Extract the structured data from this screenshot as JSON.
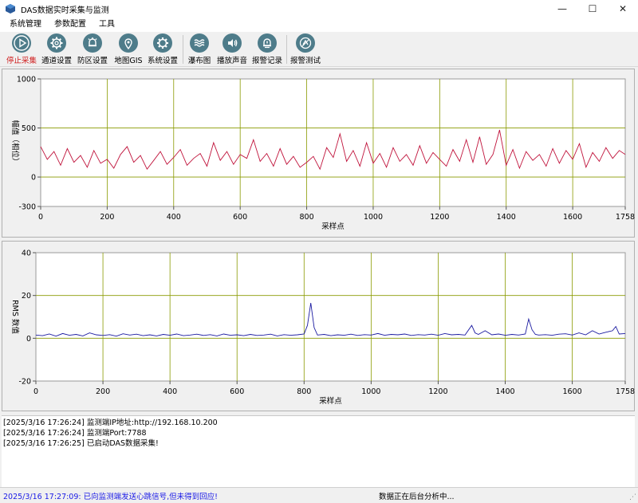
{
  "window": {
    "title": "DAS数据实时采集与监测",
    "minimize": "—",
    "maximize": "☐",
    "close": "✕"
  },
  "menu": [
    "系统管理",
    "参数配置",
    "工具"
  ],
  "toolbar": [
    {
      "label": "停止采集",
      "icon": "play-icon",
      "active": true
    },
    {
      "label": "通道设置",
      "icon": "gear-icon"
    },
    {
      "label": "防区设置",
      "icon": "alarm-bell-icon"
    },
    {
      "label": "地图GIS",
      "icon": "map-pin-icon"
    },
    {
      "label": "系统设置",
      "icon": "settings-icon"
    },
    {
      "label": "瀑布图",
      "icon": "waterfall-icon"
    },
    {
      "label": "播放声音",
      "icon": "speaker-icon"
    },
    {
      "label": "报警记录",
      "icon": "alarm-record-icon"
    },
    {
      "label": "报警测试",
      "icon": "alarm-test-icon"
    }
  ],
  "colors": {
    "grid": "#8a9a00",
    "series1": "#c0143c",
    "series2": "#1a1aa0",
    "accent_red": "#d02020",
    "status_blue": "#1a1ae6"
  },
  "chart_data": [
    {
      "type": "line",
      "title": "",
      "xlabel": "采样点",
      "ylabel": "幅值（相位）",
      "xlim": [
        0,
        1758
      ],
      "ylim": [
        -300,
        1000
      ],
      "xticks": [
        0,
        200,
        400,
        600,
        800,
        1000,
        1200,
        1400,
        1600,
        1758
      ],
      "yticks": [
        -300,
        0,
        500,
        1000
      ],
      "grid": true,
      "series": [
        {
          "x": [
            0,
            20,
            40,
            60,
            80,
            100,
            120,
            140,
            160,
            180,
            200,
            220,
            240,
            260,
            280,
            300,
            320,
            340,
            360,
            380,
            400,
            420,
            440,
            460,
            480,
            500,
            520,
            540,
            560,
            580,
            600,
            620,
            640,
            660,
            680,
            700,
            720,
            740,
            760,
            780,
            800,
            820,
            840,
            860,
            880,
            900,
            920,
            940,
            960,
            980,
            1000,
            1020,
            1040,
            1060,
            1080,
            1100,
            1120,
            1140,
            1160,
            1180,
            1200,
            1220,
            1240,
            1260,
            1280,
            1300,
            1320,
            1340,
            1360,
            1380,
            1400,
            1420,
            1440,
            1460,
            1480,
            1500,
            1520,
            1540,
            1560,
            1580,
            1600,
            1620,
            1640,
            1660,
            1680,
            1700,
            1720,
            1740,
            1758
          ],
          "y": [
            310,
            180,
            260,
            120,
            290,
            150,
            220,
            100,
            270,
            140,
            180,
            90,
            230,
            310,
            150,
            220,
            80,
            170,
            260,
            130,
            200,
            280,
            120,
            190,
            240,
            110,
            350,
            170,
            260,
            130,
            230,
            190,
            380,
            160,
            240,
            110,
            290,
            130,
            210,
            100,
            150,
            210,
            80,
            300,
            200,
            440,
            160,
            270,
            110,
            350,
            140,
            240,
            100,
            300,
            160,
            230,
            120,
            320,
            140,
            250,
            180,
            110,
            280,
            160,
            380,
            150,
            410,
            130,
            230,
            480,
            120,
            280,
            90,
            260,
            170,
            230,
            110,
            290,
            140,
            270,
            180,
            340,
            100,
            250,
            160,
            300,
            190,
            270,
            230
          ]
        }
      ]
    },
    {
      "type": "line",
      "title": "",
      "xlabel": "采样点",
      "ylabel": "RMS 数值",
      "xlim": [
        0,
        1758
      ],
      "ylim": [
        -20,
        40
      ],
      "xticks": [
        0,
        200,
        400,
        600,
        800,
        1000,
        1200,
        1400,
        1600,
        1758
      ],
      "yticks": [
        -20,
        0,
        20,
        40
      ],
      "grid": true,
      "series": [
        {
          "x": [
            0,
            20,
            40,
            60,
            80,
            100,
            120,
            140,
            160,
            180,
            200,
            220,
            240,
            260,
            280,
            300,
            320,
            340,
            360,
            380,
            400,
            420,
            440,
            460,
            480,
            500,
            520,
            540,
            560,
            580,
            600,
            620,
            640,
            660,
            680,
            700,
            720,
            740,
            760,
            780,
            800,
            810,
            820,
            830,
            840,
            860,
            880,
            900,
            920,
            940,
            960,
            980,
            1000,
            1020,
            1040,
            1060,
            1080,
            1100,
            1120,
            1140,
            1160,
            1180,
            1200,
            1220,
            1240,
            1260,
            1280,
            1300,
            1310,
            1320,
            1340,
            1360,
            1380,
            1400,
            1420,
            1440,
            1460,
            1470,
            1480,
            1490,
            1500,
            1520,
            1540,
            1560,
            1580,
            1600,
            1620,
            1640,
            1660,
            1680,
            1700,
            1720,
            1730,
            1740,
            1758
          ],
          "y": [
            1.5,
            1.2,
            2.0,
            1.0,
            2.2,
            1.4,
            1.8,
            1.1,
            2.5,
            1.6,
            1.3,
            1.7,
            1.0,
            2.1,
            1.5,
            1.9,
            1.2,
            1.6,
            1.1,
            1.8,
            1.4,
            2.0,
            1.2,
            1.5,
            1.9,
            1.3,
            1.7,
            1.1,
            2.0,
            1.4,
            1.6,
            1.2,
            1.8,
            1.3,
            1.5,
            1.9,
            1.1,
            1.7,
            1.4,
            1.6,
            2.0,
            6.0,
            16.5,
            5.0,
            1.5,
            1.8,
            1.2,
            1.6,
            1.4,
            1.9,
            1.3,
            1.7,
            1.5,
            2.2,
            1.4,
            1.8,
            1.6,
            2.0,
            1.3,
            1.7,
            1.5,
            1.9,
            1.4,
            2.2,
            1.6,
            1.8,
            1.5,
            6.0,
            2.5,
            1.8,
            3.5,
            1.6,
            2.0,
            1.4,
            1.8,
            1.5,
            2.0,
            9.0,
            4.0,
            1.8,
            1.5,
            1.7,
            1.4,
            1.9,
            2.1,
            1.5,
            2.5,
            1.6,
            3.5,
            2.0,
            2.8,
            3.5,
            5.5,
            2.0,
            2.2
          ]
        }
      ]
    }
  ],
  "log": [
    "[2025/3/16 17:26:24] 监测端IP地址:http://192.168.10.200",
    "[2025/3/16 17:26:24] 监测端Port:7788",
    "[2025/3/16 17:26:25] 已启动DAS数据采集!"
  ],
  "status": {
    "left": "2025/3/16 17:27:09: 已向监测端发送心跳信号,但未得到回应!",
    "center": "数据正在后台分析中..."
  }
}
